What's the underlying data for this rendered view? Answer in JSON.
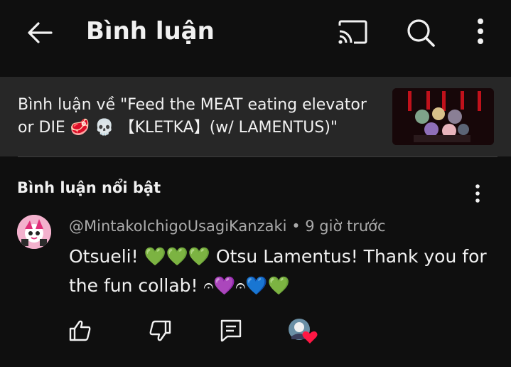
{
  "header": {
    "title": "Bình luận",
    "icons": [
      "back-arrow-icon",
      "cast-icon",
      "search-icon",
      "more-vert-icon"
    ]
  },
  "video": {
    "caption": "Bình luận về \"Feed the MEAT eating elevator or DIE 🥩 💀 【KLETKA】(w/ LAMENTUS)\"",
    "thumbnail_icon": "video-thumbnail"
  },
  "section": {
    "title": "Bình luận nổi bật"
  },
  "comment": {
    "author": "@MintakoIchigoUsagiKanzaki",
    "separator": "•",
    "time": "9 giờ trước",
    "text": "Otsueli! 💚💚💚 Otsu Lamentus! Thank you for the fun collab! 𝄐💜𝄐💙💚",
    "actions": [
      "like-icon",
      "dislike-icon",
      "reply-icon",
      "creator-heart-icon"
    ]
  },
  "colors": {
    "background": "#0f0f0f",
    "banner": "#272727",
    "secondary_text": "#aaaaaa",
    "heart": "#ff1744"
  }
}
